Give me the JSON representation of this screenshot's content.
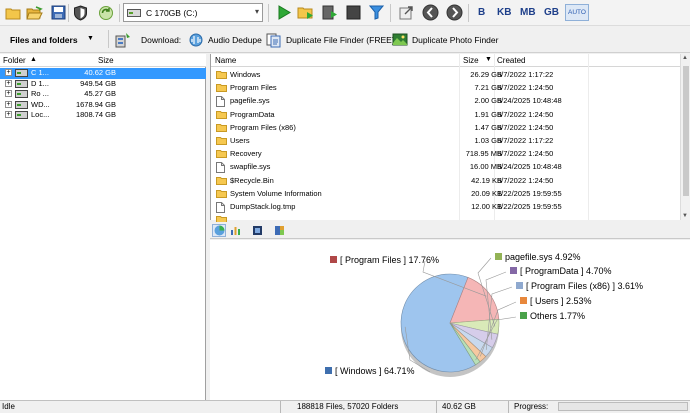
{
  "toolbar": {
    "drive_select": "C 170GB (C:)",
    "units": [
      "B",
      "KB",
      "MB",
      "GB"
    ],
    "unit_auto": "AUTO",
    "icons": [
      "folder-icon",
      "open-folder-icon",
      "save-icon",
      "shield-icon",
      "refresh-icon",
      "play-icon",
      "folder-play-icon",
      "scan-icon",
      "stop-icon",
      "filter-icon",
      "export-icon",
      "back-icon",
      "forward-icon"
    ]
  },
  "bar2": {
    "files_and_folders": "Files and folders",
    "download_label": "Download:",
    "audio_dedupe": "Audio Dedupe",
    "duplicate_file_finder": "Duplicate File Finder (FREE)",
    "duplicate_photo_finder": "Duplicate Photo Finder"
  },
  "tree": {
    "headers": {
      "folder": "Folder",
      "size": "Size"
    },
    "rows": [
      {
        "name": "C 1...",
        "size": "40.62 GB",
        "selected": true
      },
      {
        "name": "D 1...",
        "size": "949.54 GB",
        "selected": false
      },
      {
        "name": "Ro ...",
        "size": "45.27 GB",
        "selected": false
      },
      {
        "name": "WD...",
        "size": "1678.94 GB",
        "selected": false
      },
      {
        "name": "Loc...",
        "size": "1808.74 GB",
        "selected": false
      }
    ]
  },
  "files": {
    "headers": {
      "name": "Name",
      "size": "Size",
      "created": "Created"
    },
    "rows": [
      {
        "icon": "folder",
        "name": "Windows",
        "size": "26.29 GB",
        "created": "5/7/2022 1:17:22"
      },
      {
        "icon": "folder",
        "name": "Program Files",
        "size": "7.21 GB",
        "created": "5/7/2022 1:24:50"
      },
      {
        "icon": "file",
        "name": "pagefile.sys",
        "size": "2.00 GB",
        "created": "5/24/2025 10:48:48"
      },
      {
        "icon": "folder",
        "name": "ProgramData",
        "size": "1.91 GB",
        "created": "5/7/2022 1:24:50"
      },
      {
        "icon": "folder",
        "name": "Program Files (x86)",
        "size": "1.47 GB",
        "created": "5/7/2022 1:24:50"
      },
      {
        "icon": "folder",
        "name": "Users",
        "size": "1.03 GB",
        "created": "5/7/2022 1:17:22"
      },
      {
        "icon": "folder",
        "name": "Recovery",
        "size": "718.95 MB",
        "created": "5/7/2022 1:24:50"
      },
      {
        "icon": "file",
        "name": "swapfile.sys",
        "size": "16.00 MB",
        "created": "5/24/2025 10:48:48"
      },
      {
        "icon": "folder",
        "name": "$Recycle.Bin",
        "size": "42.19 KB",
        "created": "5/7/2022 1:24:50"
      },
      {
        "icon": "folder",
        "name": "System Volume Information",
        "size": "20.09 KB",
        "created": "1/22/2025 19:59:55"
      },
      {
        "icon": "file",
        "name": "DumpStack.log.tmp",
        "size": "12.00 KB",
        "created": "1/22/2025 19:59:55"
      },
      {
        "icon": "folder",
        "name": "",
        "size": "",
        "created": ""
      }
    ]
  },
  "chart_tabs": [
    "pie-chart-icon",
    "bar-chart-icon",
    "list-chart-icon",
    "tree-chart-icon"
  ],
  "chart_data": {
    "type": "pie",
    "slices": [
      {
        "label": "[ Windows ] 64.71%",
        "value": 64.71,
        "color": "#9ec5ee"
      },
      {
        "label": "[ Program Files ] 17.76%",
        "value": 17.76,
        "color": "#f5b6b6"
      },
      {
        "label": "pagefile.sys 4.92%",
        "value": 4.92,
        "color": "#d9eab8"
      },
      {
        "label": "[ ProgramData ] 4.70%",
        "value": 4.7,
        "color": "#d6cdea"
      },
      {
        "label": "[ Program Files (x86) ] 3.61%",
        "value": 3.61,
        "color": "#c8d9ee"
      },
      {
        "label": "[ Users ] 2.53%",
        "value": 2.53,
        "color": "#f6c8a0"
      },
      {
        "label": "Others 1.77%",
        "value": 1.77,
        "color": "#b8e0b8"
      }
    ],
    "legend_colors": [
      "#3f6fae",
      "#b04848",
      "#93b356",
      "#8468a6",
      "#8fa9cf",
      "#e8883c",
      "#4aa24a"
    ]
  },
  "status": {
    "left": "Idle",
    "counts": "188818 Files, 57020 Folders",
    "total": "40.62 GB",
    "progress_label": "Progress:"
  }
}
